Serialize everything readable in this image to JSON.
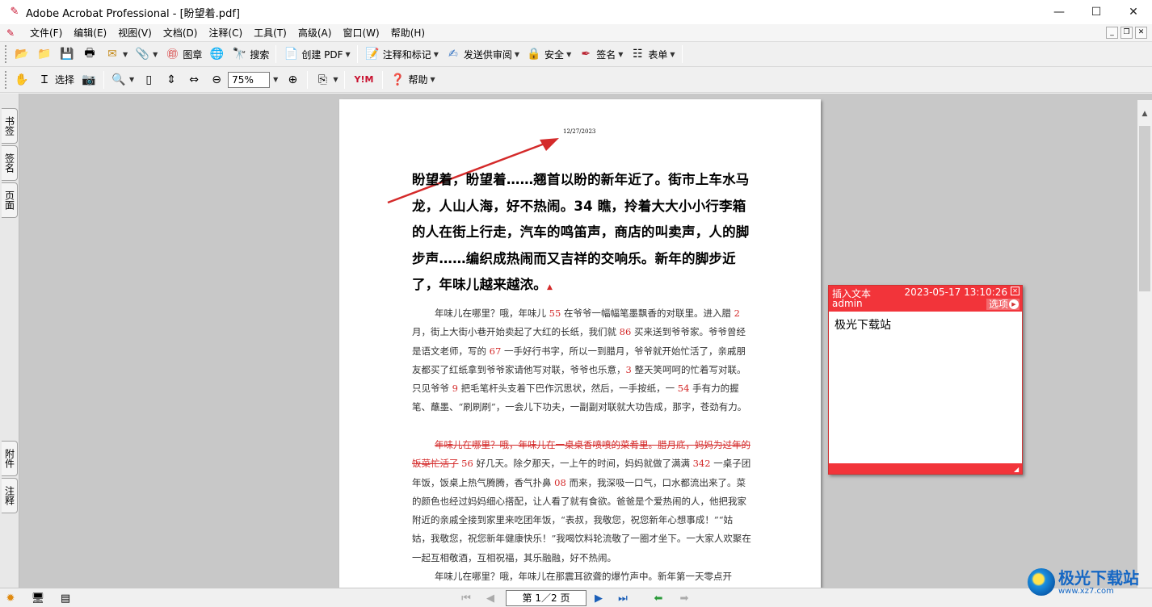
{
  "window": {
    "title": "Adobe Acrobat Professional - [盼望着.pdf]",
    "minimize": "—",
    "maximize": "☐",
    "close": "✕"
  },
  "menu": {
    "items": [
      "文件(F)",
      "编辑(E)",
      "视图(V)",
      "文档(D)",
      "注释(C)",
      "工具(T)",
      "高级(A)",
      "窗口(W)",
      "帮助(H)"
    ]
  },
  "toolbar1": {
    "stamp_label": "图章",
    "search_label": "搜索",
    "create_pdf_label": "创建 PDF",
    "comment_markup_label": "注释和标记",
    "send_review_label": "发送供审阅",
    "security_label": "安全",
    "sign_label": "签名",
    "forms_label": "表单"
  },
  "toolbar2": {
    "select_label": "选择",
    "zoom_value": "75%",
    "help_label": "帮助"
  },
  "left_tabs": {
    "bookmarks": "书签",
    "signatures": "签名",
    "pages": "页面",
    "attachments": "附件",
    "comments": "注释"
  },
  "document": {
    "date": "12/27/2023",
    "heading": "盼望着，盼望着……翘首以盼的新年近了。街市上车水马龙，人山人海，好不热闹。34 瞧，拎着大大小小行李箱的人在街上行走，汽车的鸣笛声，商店的叫卖声，人的脚步声……编织成热闹而又吉祥的交响乐。新年的脚步近了，年味儿越来越浓。",
    "p1": {
      "t1": "年味儿在哪里？哦，年味儿 ",
      "n1": "55",
      "t2": " 在爷爷一幅幅笔墨飘香的对联里。进入腊 ",
      "n2": "2",
      "t3": " 月，街上大街小巷开始卖起了大红的长纸，我们就 ",
      "n3": "86",
      "t4": " 买来送到爷爷家。爷爷曾经是语文老师，写的 ",
      "n4": "67",
      "t5": " 一手好行书字，所以一到腊月，爷爷就开始忙活了，亲戚朋友都买了红纸拿到爷爷家请他写对联，爷爷也乐意，",
      "n5": "3",
      "t6": " 整天笑呵呵的忙着写对联。只见爷爷 ",
      "n6": "9",
      "t7": " 把毛笔杆头支着下巴作沉思状，然后，一手按纸，一 ",
      "n7": "54",
      "t8": " 手有力的握笔、蘸墨、“刷刷刷”，一会儿下功夫，一副副对联就大功告成，那字，苍劲有力。"
    },
    "p2": {
      "struck": "年味儿在哪里？哦，年味儿在一桌桌香喷喷的菜肴里。腊月底，妈妈为过年的饭菜忙活了",
      "t1": " ",
      "n1": "56",
      "t2": " 好几天。除夕那天，一上午的时间，妈妈就做了满满 ",
      "n2": "342",
      "t3": " 一桌子团年饭，饭桌上热气腾腾，香气扑鼻 ",
      "n3": "08",
      "t4": " 而来，我深吸一口气，口水都流出来了。菜的颜色也经过妈妈细心搭配，让人看了就有食欲。爸爸是个爱热闹的人，他把我家附近的亲戚全接到家里来吃团年饭，“表叔，我敬您，祝您新年心想事成！”“姑姑，我敬您，祝您新年健康快乐！”我喝饮料轮流敬了一圈才坐下。一大家人欢聚在一起互相敬酒，互相祝福，其乐融融，好不热闹。"
    },
    "p3": "年味儿在哪里？哦，年味儿在那震耳欲聋的爆竹声中。新年第一天零点开"
  },
  "note": {
    "type": "插入文本",
    "timestamp": "2023-05-17 13:10:26",
    "author": "admin",
    "options_label": "选项",
    "content": "极光下载站"
  },
  "statusbar": {
    "page_indicator": "第 1／2 页"
  },
  "watermark": {
    "brand": "极光下载站",
    "url": "www.xz7.com"
  },
  "colors": {
    "note_red": "#f2343a",
    "arrow_red": "#d42a2a",
    "markup_red": "#d42a2a"
  }
}
